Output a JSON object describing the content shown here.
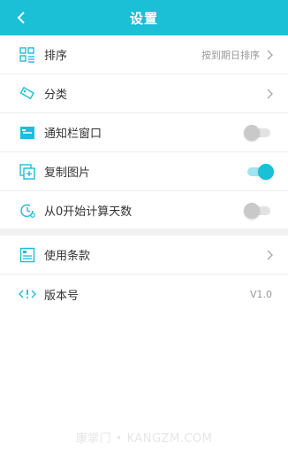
{
  "header": {
    "title": "设置",
    "bg_color": "#1bbfd6"
  },
  "settings": {
    "sort": {
      "label": "排序",
      "value": "按到期日排序",
      "icon": "sort-grid-icon"
    },
    "category": {
      "label": "分类",
      "icon": "tag-icon"
    },
    "notification_bar": {
      "label": "通知栏窗口",
      "toggle": false,
      "icon": "notification-icon"
    },
    "copy_image": {
      "label": "复制图片",
      "toggle": true,
      "icon": "copy-image-icon"
    },
    "start_from_zero": {
      "label": "从0开始计算天数",
      "toggle": false,
      "icon": "count-icon"
    }
  },
  "about": {
    "terms": {
      "label": "使用条款",
      "icon": "document-icon"
    },
    "version": {
      "label": "版本号",
      "value": "V1.0",
      "icon": "code-icon"
    }
  },
  "watermark": "康掌门 • KANGZM.COM",
  "accent_color": "#1bbfd6"
}
